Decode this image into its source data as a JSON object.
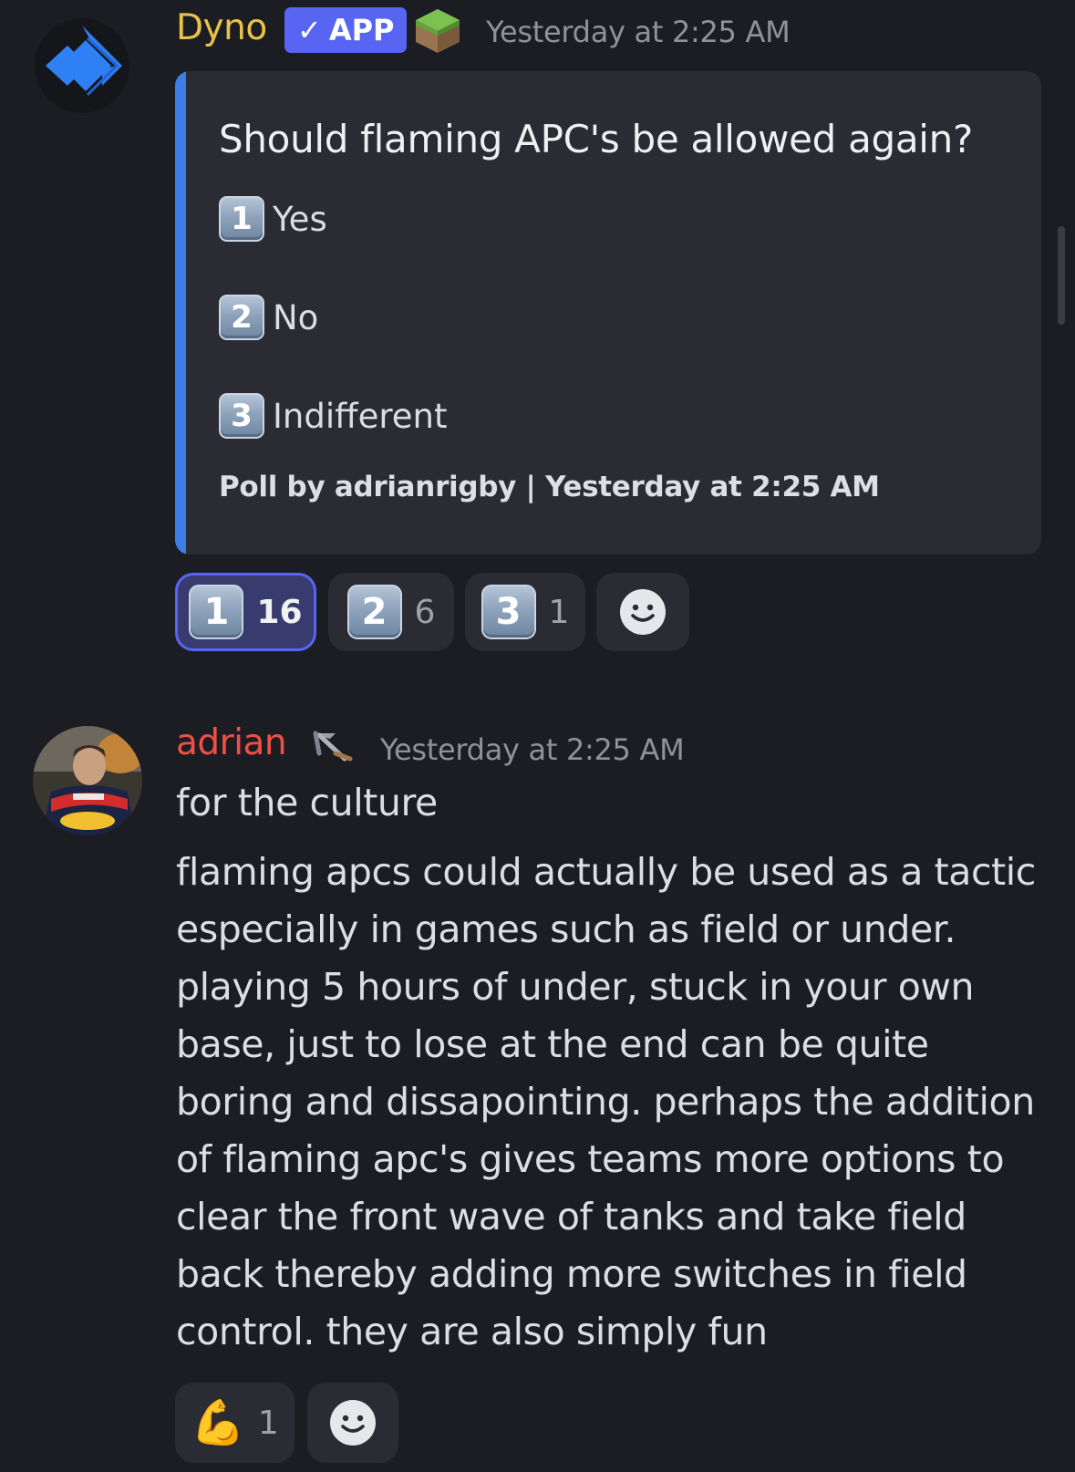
{
  "bot_message": {
    "author": "Dyno",
    "badge": "APP",
    "timestamp": "Yesterday at 2:25 AM",
    "embed": {
      "title": "Should flaming APC's be allowed again?",
      "options": [
        {
          "key": "1",
          "label": "Yes"
        },
        {
          "key": "2",
          "label": "No"
        },
        {
          "key": "3",
          "label": "Indifferent"
        }
      ],
      "footer": "Poll by adrianrigby | Yesterday at 2:25 AM",
      "accent_color": "#3d7ee6"
    },
    "reactions": [
      {
        "key": "1",
        "count": "16",
        "active": true
      },
      {
        "key": "2",
        "count": "6",
        "active": false
      },
      {
        "key": "3",
        "count": "1",
        "active": false
      }
    ]
  },
  "user_message": {
    "author": "adrian",
    "timestamp": "Yesterday at 2:25 AM",
    "lines": [
      "for the culture",
      "flaming apcs could actually be used as a tactic especially in games such as field or under. playing 5 hours of under, stuck in your own base, just to lose at the end can be quite boring and dissapointing. perhaps the addition of flaming apc's gives teams more options to clear the front wave of tanks and take field back thereby adding more switches in field control. they are also simply fun"
    ],
    "reactions": [
      {
        "emoji": "💪",
        "count": "1"
      }
    ]
  },
  "colors": {
    "background": "#1c1d22",
    "bot_name": "#e9c249",
    "user_name": "#ef5046",
    "app_badge": "#5865f2",
    "active_reaction_border": "#5865f2"
  }
}
